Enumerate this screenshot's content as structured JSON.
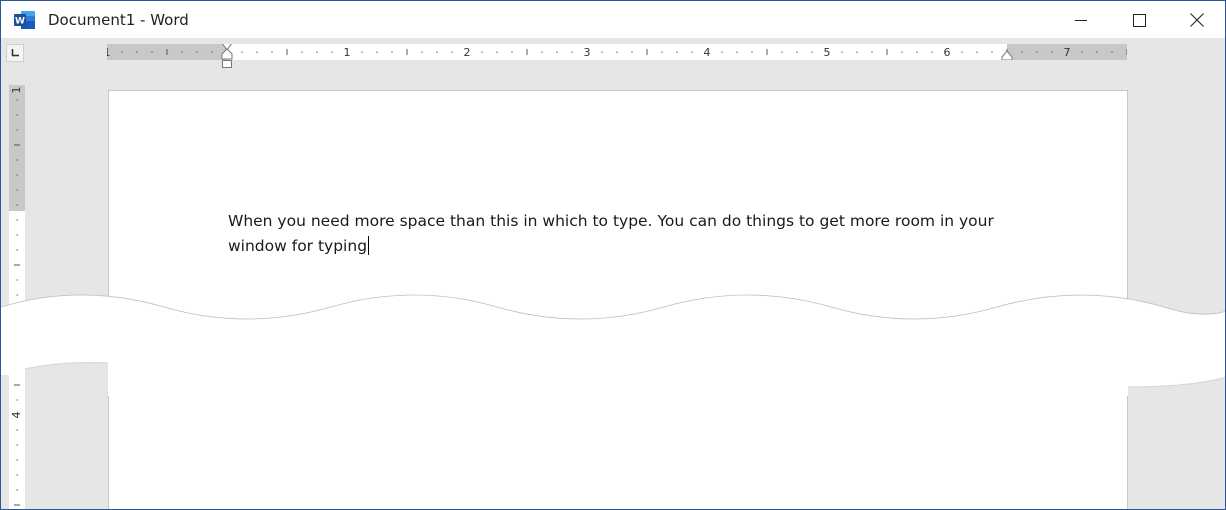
{
  "window": {
    "title": "Document1 - Word",
    "app_icon": "word-icon",
    "app_icon_letter": "W",
    "controls": {
      "minimize": "minimize-icon",
      "maximize": "maximize-icon",
      "close": "close-icon"
    }
  },
  "ruler": {
    "horizontal_labels": [
      "1",
      "1",
      "2",
      "3",
      "4",
      "5",
      "6",
      "7"
    ],
    "vertical_labels": [
      "1",
      "4"
    ],
    "tab_selector": "left-tab-icon"
  },
  "document": {
    "body_text": "When you need more space than this in which to type. You can do things to get more room in your window for typing"
  },
  "colors": {
    "word_brand": "#2b579a",
    "ruler_margin": "#c8c8c8",
    "workspace": "#e6e6e6"
  }
}
